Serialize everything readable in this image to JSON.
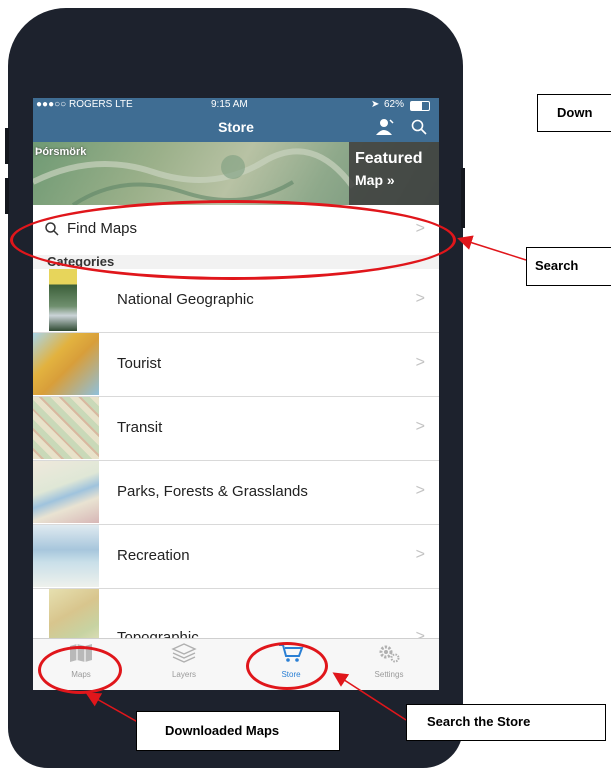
{
  "status_bar": {
    "carrier": "●●●○○ ROGERS  LTE",
    "time": "9:15 AM",
    "battery": "62%"
  },
  "nav": {
    "title": "Store"
  },
  "featured": {
    "place": "Þórsmörk",
    "label_line1": "Featured",
    "label_line2": "Map »"
  },
  "search": {
    "label": "Find Maps"
  },
  "categories": {
    "header": "Categories",
    "items": [
      {
        "label": "National Geographic"
      },
      {
        "label": "Tourist"
      },
      {
        "label": "Transit"
      },
      {
        "label": "Parks, Forests & Grasslands"
      },
      {
        "label": "Recreation"
      },
      {
        "label": "Topographic"
      }
    ]
  },
  "tabbar": {
    "items": [
      {
        "label": "Maps",
        "icon": "map-icon"
      },
      {
        "label": "Layers",
        "icon": "layers-icon"
      },
      {
        "label": "Store",
        "icon": "cart-icon"
      },
      {
        "label": "Settings",
        "icon": "gear-icon"
      }
    ]
  },
  "annotations": {
    "downloads_top": "Down",
    "search_right": "Search",
    "downloaded_maps": "Downloaded Maps",
    "search_store": "Search the Store"
  },
  "colors": {
    "nav_bar": "#3f6d93",
    "highlight_red": "#e0161b",
    "active_tab": "#2a7fd4",
    "phone_body": "#1d222d"
  }
}
